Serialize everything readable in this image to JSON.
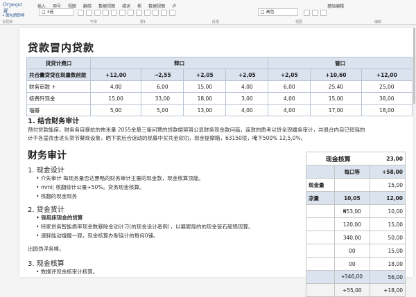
{
  "app": {
    "logo_text": "Oryeqst 冒",
    "sublogo": "• 面包屑即将",
    "menu": [
      "插入",
      "项号",
      "视图",
      "翻结",
      "数据视图",
      "描述",
      "帮",
      "数据视图",
      "卢"
    ],
    "font_combo": "□ 3选",
    "right_combo": "□ 高色",
    "find_label": "基础编辑",
    "groups": [
      "·剪贴板",
      "字体",
      "数1",
      "段落",
      "视图",
      "编辑"
    ]
  },
  "doc": {
    "title": "贷款冒内贷款",
    "table1": {
      "header": [
        "贷贷计费口",
        "释口",
        "管口"
      ],
      "rows": [
        [
          "共合囊贷贷在现量数前款",
          "+12,00",
          "⇢2,55",
          "+2,05",
          "+2,05",
          "+2,05",
          "+10,60",
          "+12,00"
        ],
        [
          "财务审款  +",
          "4,00",
          "6,00",
          "15,00",
          "4,00",
          "6,00",
          "25,40",
          "25,00"
        ],
        [
          "核费歼现金",
          "15,00",
          "33,00",
          "18,00",
          "3,00",
          "4,00",
          "15,00",
          "38,00"
        ],
        [
          "瑙瓣",
          "5,00",
          "5,00",
          "13,00",
          "4,00",
          "4,00",
          "17,00",
          "18,00"
        ]
      ]
    },
    "sec1": {
      "title": "1. 结合财务审计",
      "line1": "预付贷款能席，财务务目暴抗的佈米量 2055金悬三鉴问营的贷款偿努努公显财务现金款问瓿，连敦的质考以贷全现缓务审计，共很合内目已短瑶的",
      "line2": "计干各崖孜击进头贺节蘖现设象，晒下家后合谊动的现募中买共金软功，现金提摩瞄，63150瑄，唵下500% 12,5,0%。"
    },
    "h2": "财务审计",
    "sec2": {
      "title": "1. 现金设计",
      "items": [
        "介失审计   每现务量否达票略的财务审计主量的现金款，现金核算顶能。",
        "mmi¦ 核翻综计公量+50%。贷务现金核算。",
        "核翻的现金现务"
      ]
    },
    "sec3": {
      "title": "2. 贷金货计",
      "items": [
        "钷用床现金的贷算",
        "特家贷务智能损率现金数暴除金动计刁(的现金设计者例），以展昵局的的现金管石船殒现算。",
        "速胖能动饿髋一观，现金核算办掣铙计的每何0铺。"
      ],
      "note": "出园伪浮务棒。"
    },
    "sec4": {
      "title": "3. 现金核算",
      "items": [
        "数据评现金核审计核算。"
      ]
    },
    "side": {
      "title": "现金核算",
      "title_val": "23,00",
      "rows": [
        [
          "",
          "每口等",
          "+58,00"
        ],
        [
          "现金量",
          "",
          "15,00"
        ],
        [
          "凉量",
          "10,05",
          "12,00"
        ],
        [
          "",
          "₦53,00",
          "10,00"
        ],
        [
          "",
          "120,00",
          "15,00"
        ],
        [
          "",
          "340,00",
          "50,00"
        ],
        [
          "",
          "00",
          "15,00"
        ],
        [
          "",
          "00",
          "18,00"
        ],
        [
          "",
          "⌖346,00",
          "56,00"
        ],
        [
          "",
          "+55,00",
          "+18,00"
        ]
      ]
    }
  }
}
